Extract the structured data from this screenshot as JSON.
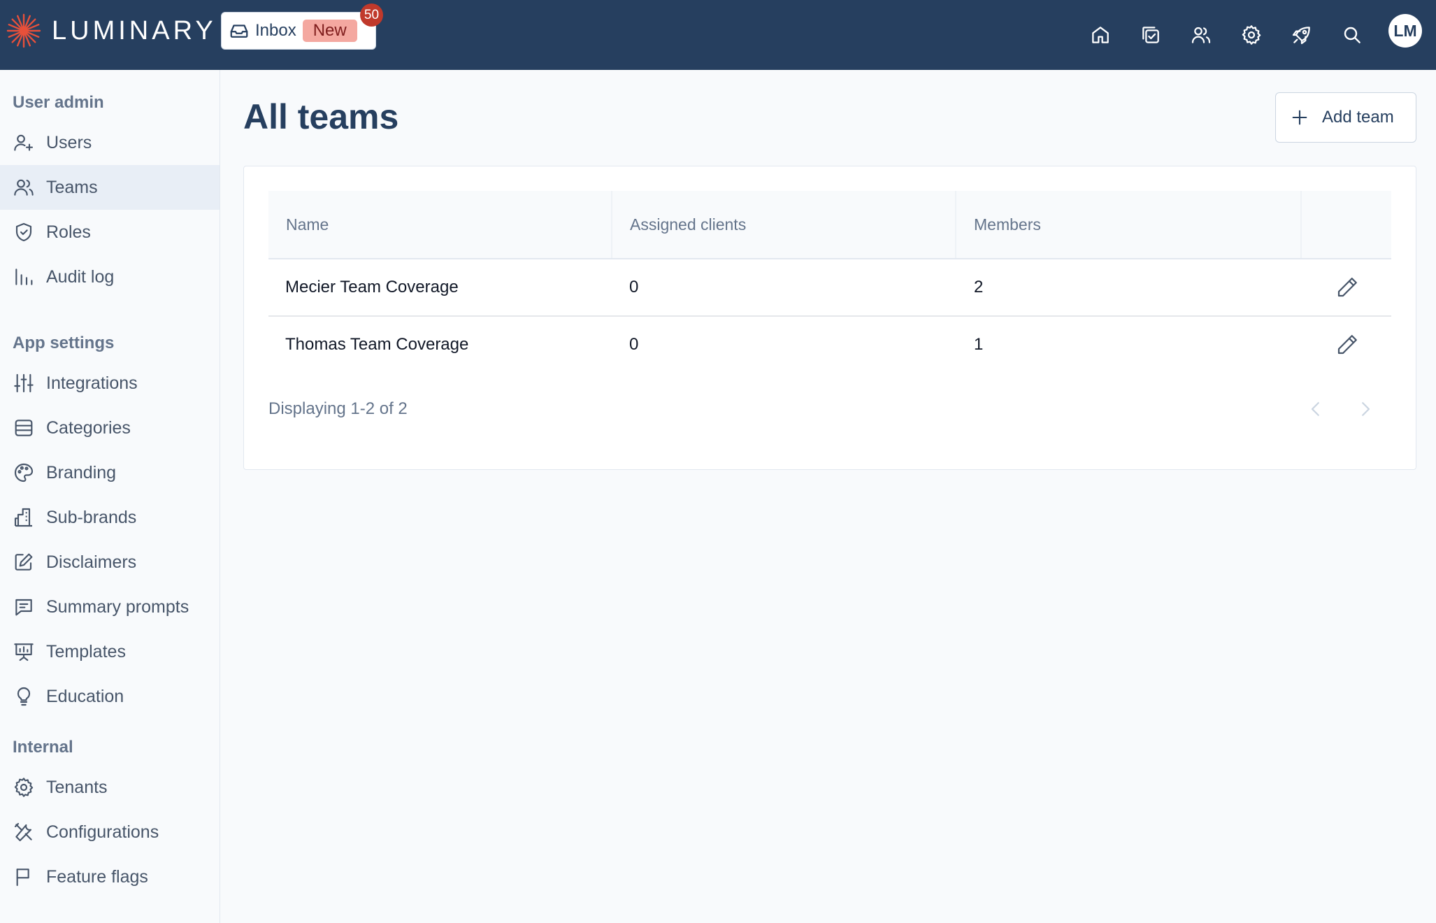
{
  "app": {
    "name": "LUMINARY"
  },
  "inbox": {
    "label": "Inbox",
    "new_label": "New",
    "count": "50"
  },
  "user": {
    "initials": "LM"
  },
  "topnav": [
    "home-icon",
    "tasks-icon",
    "people-icon",
    "settings-icon",
    "rocket-icon",
    "search-icon"
  ],
  "sidebar": {
    "sections": [
      {
        "title": "User admin",
        "items": [
          {
            "label": "Users",
            "icon": "user-plus-icon"
          },
          {
            "label": "Teams",
            "icon": "users-icon",
            "active": true
          },
          {
            "label": "Roles",
            "icon": "shield-icon"
          },
          {
            "label": "Audit log",
            "icon": "bar-chart-icon"
          }
        ]
      },
      {
        "title": "App settings",
        "items": [
          {
            "label": "Integrations",
            "icon": "sliders-icon"
          },
          {
            "label": "Categories",
            "icon": "layers-icon"
          },
          {
            "label": "Branding",
            "icon": "palette-icon"
          },
          {
            "label": "Sub-brands",
            "icon": "building-icon"
          },
          {
            "label": "Disclaimers",
            "icon": "edit-icon"
          },
          {
            "label": "Summary prompts",
            "icon": "message-icon"
          },
          {
            "label": "Templates",
            "icon": "presentation-icon"
          },
          {
            "label": "Education",
            "icon": "lightbulb-icon"
          }
        ]
      },
      {
        "title": "Internal",
        "items": [
          {
            "label": "Tenants",
            "icon": "gear-icon"
          },
          {
            "label": "Configurations",
            "icon": "tools-icon"
          },
          {
            "label": "Feature flags",
            "icon": "flag-icon"
          }
        ]
      }
    ]
  },
  "main": {
    "title": "All teams",
    "add_button": "Add team",
    "table": {
      "columns": [
        "Name",
        "Assigned clients",
        "Members",
        ""
      ],
      "rows": [
        {
          "name": "Mecier Team Coverage",
          "clients": "0",
          "members": "2"
        },
        {
          "name": "Thomas Team Coverage",
          "clients": "0",
          "members": "1"
        }
      ]
    },
    "pagination": {
      "text": "Displaying 1-2 of 2"
    }
  },
  "colors": {
    "topbar": "#263f5f",
    "accent": "#e8503a",
    "badge": "#c0392b",
    "new_pill": "#f4a8a0"
  }
}
